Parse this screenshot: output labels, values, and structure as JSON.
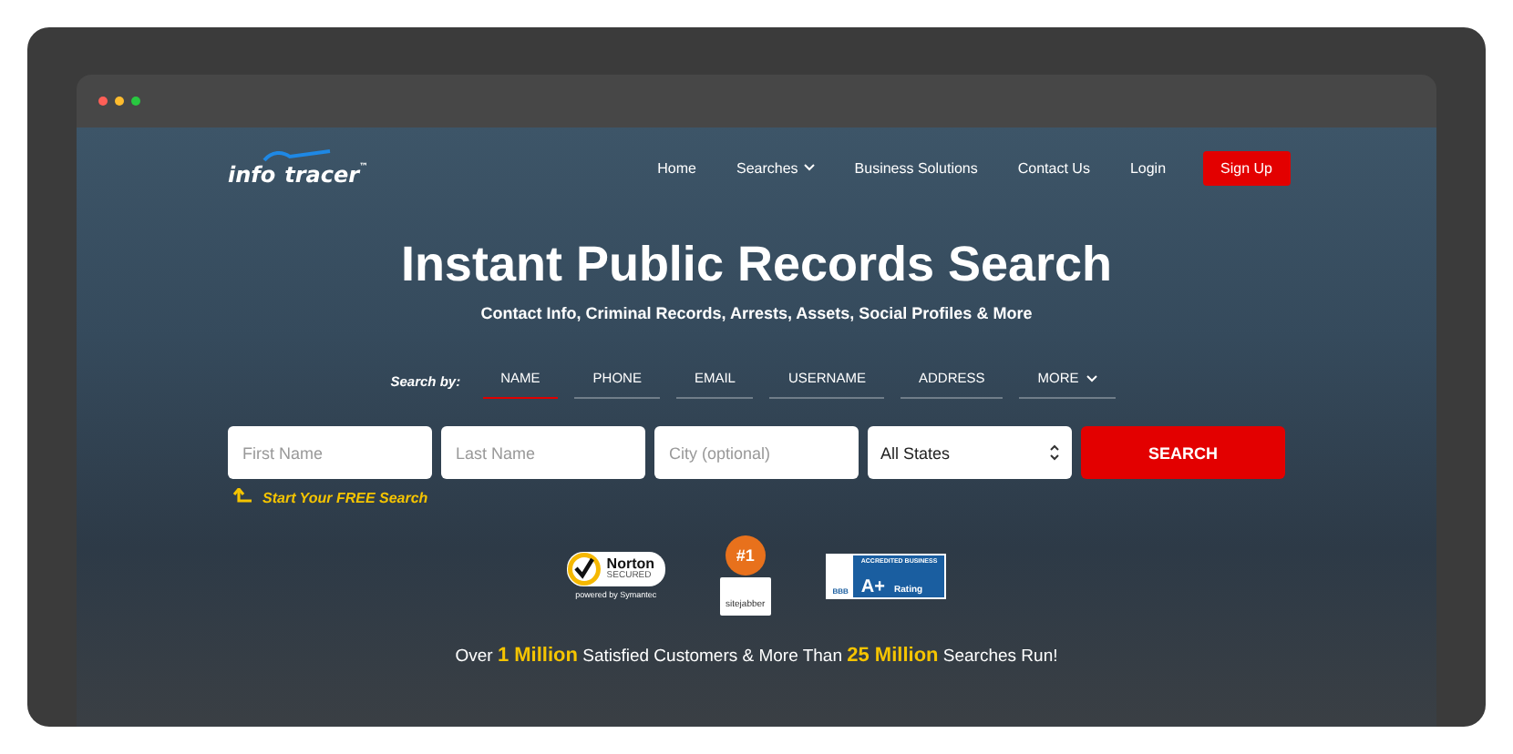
{
  "logo": {
    "part_1": "info",
    "part_2": "tracer",
    "mark": "™"
  },
  "nav": [
    {
      "label": "Home",
      "kind": "link"
    },
    {
      "label": "Searches",
      "kind": "dropdown"
    },
    {
      "label": "Business Solutions",
      "kind": "link"
    },
    {
      "label": "Contact Us",
      "kind": "link"
    },
    {
      "label": "Login",
      "kind": "link"
    },
    {
      "label": "Sign Up",
      "kind": "button"
    }
  ],
  "hero": {
    "title": "Instant Public Records Search",
    "subtitle": "Contact Info, Criminal Records, Arrests, Assets, Social Profiles & More"
  },
  "search_by": {
    "label": "Search by:",
    "tabs": [
      {
        "label": "NAME",
        "selected": true,
        "dropdown": false
      },
      {
        "label": "PHONE",
        "selected": false,
        "dropdown": false
      },
      {
        "label": "EMAIL",
        "selected": false,
        "dropdown": false
      },
      {
        "label": "USERNAME",
        "selected": false,
        "dropdown": false
      },
      {
        "label": "ADDRESS",
        "selected": false,
        "dropdown": false
      },
      {
        "label": "MORE",
        "selected": false,
        "dropdown": true
      }
    ]
  },
  "form": {
    "fields": [
      {
        "placeholder": "First Name"
      },
      {
        "placeholder": "Last Name"
      },
      {
        "placeholder": "City (optional)"
      }
    ],
    "state_select": {
      "value": "All States"
    },
    "button": "SEARCH",
    "hint": "Start Your FREE Search"
  },
  "badges": {
    "norton": {
      "name": "Norton",
      "secured": "SECURED",
      "powered": "powered by Symantec"
    },
    "sitejabber": {
      "rank": "#1",
      "name": "sitejabber"
    },
    "bbb": {
      "accredited": "ACCREDITED BUSINESS",
      "grade": "A+",
      "rating": "Rating",
      "name": "BBB"
    }
  },
  "stats": "Over **1 Million** Satisfied Customers & More Than **25 Million** Searches Run!"
}
